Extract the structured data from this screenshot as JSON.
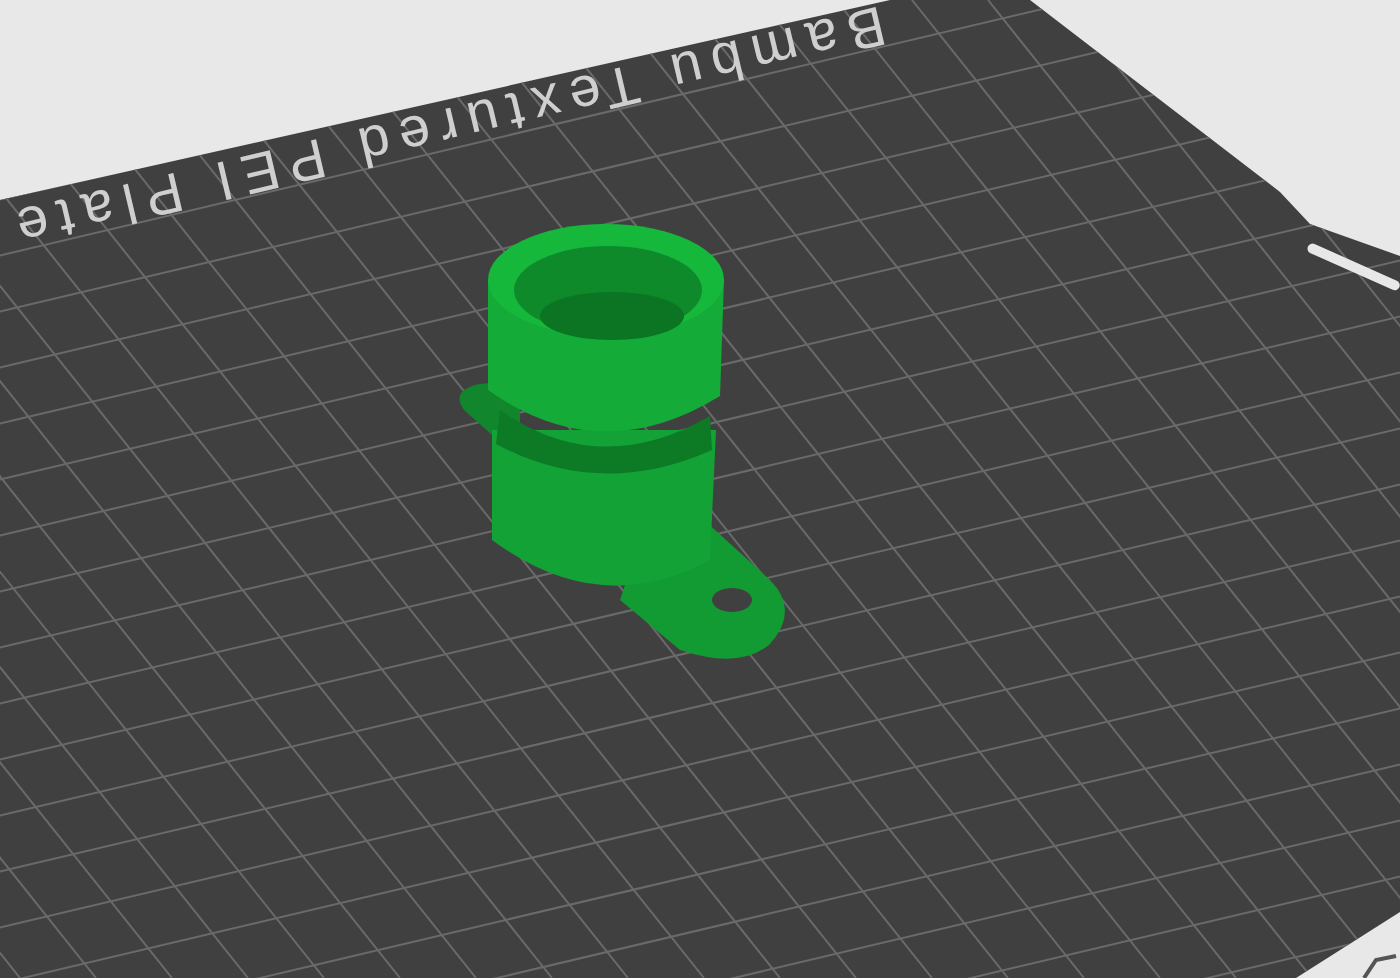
{
  "viewport": {
    "plate_label": "Bambu Textured PEI Plate"
  }
}
